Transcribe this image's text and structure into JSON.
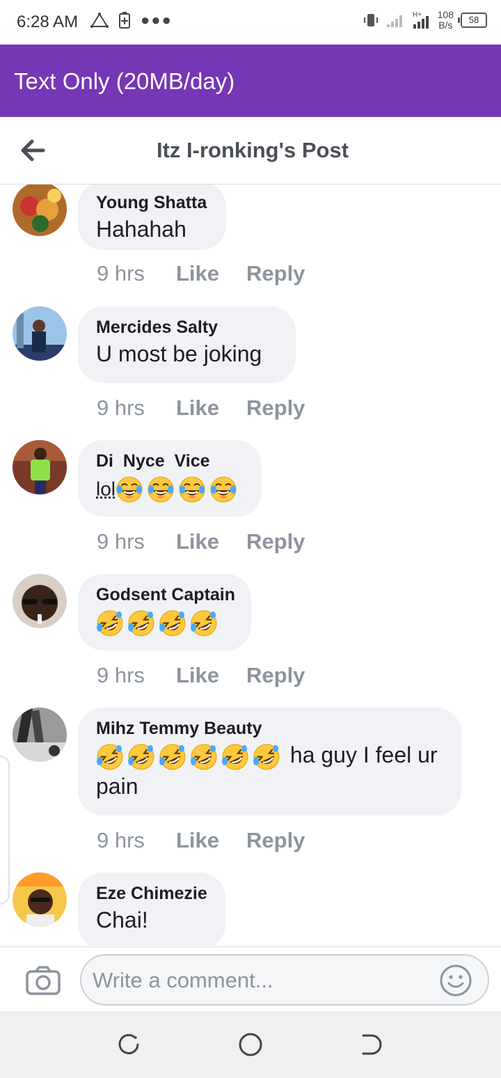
{
  "status_bar": {
    "time": "6:28 AM",
    "net_speed_value": "108",
    "net_speed_unit": "B/s",
    "battery": "58",
    "network_type": "H+"
  },
  "banner": {
    "text": "Text Only (20MB/day)"
  },
  "header": {
    "title": "Itz I-ronking's Post",
    "back_icon": "arrow-left-icon"
  },
  "comments": [
    {
      "name": "Young Shatta",
      "text": "Hahahah",
      "time": "9 hrs",
      "like": "Like",
      "reply": "Reply"
    },
    {
      "name": "Mercides Salty",
      "text": "U most be joking",
      "time": "9 hrs",
      "like": "Like",
      "reply": "Reply"
    },
    {
      "name": "Di  Nyce  Vice",
      "text": "lol",
      "emoji": "tears-of-joy",
      "emoji_count": 4,
      "time": "9 hrs",
      "like": "Like",
      "reply": "Reply"
    },
    {
      "name": "Godsent Captain",
      "text": "",
      "emoji": "rolling-on-floor-laughing",
      "emoji_count": 4,
      "time": "9 hrs",
      "like": "Like",
      "reply": "Reply"
    },
    {
      "name": "Mihz Temmy Beauty",
      "text": " ha guy I feel ur pain",
      "emoji": "rolling-on-floor-laughing",
      "emoji_count": 6,
      "time": "9 hrs",
      "like": "Like",
      "reply": "Reply"
    },
    {
      "name": "Eze Chimezie",
      "text": "Chai!",
      "time": "",
      "like": "",
      "reply": ""
    }
  ],
  "composer": {
    "placeholder": "Write a comment...",
    "camera_icon": "camera-icon",
    "emoji_icon": "smiley-icon"
  },
  "colors": {
    "brand_purple": "#7537b6",
    "bubble": "#f0f2f5",
    "meta_gray": "#8d949e"
  }
}
